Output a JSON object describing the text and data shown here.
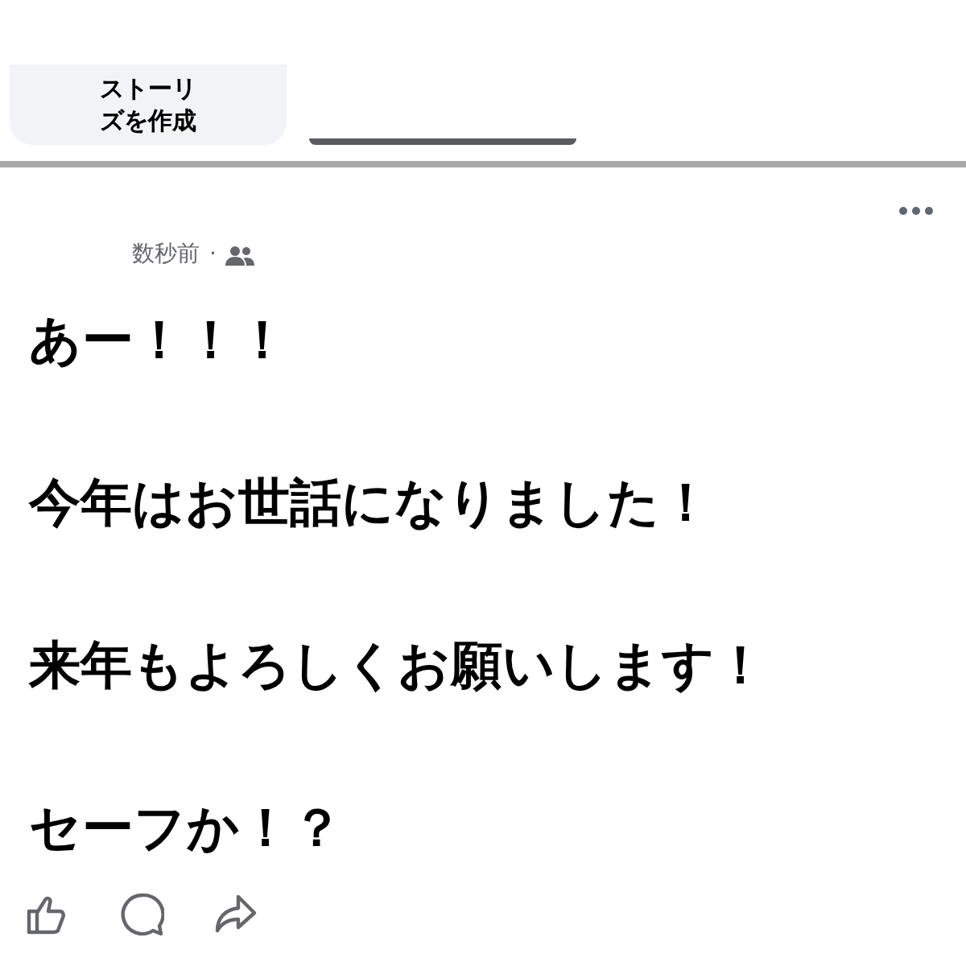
{
  "story_card": {
    "lines": [
      "ストーリ",
      "ズを作成"
    ]
  },
  "post": {
    "time": "数秒前",
    "separator": "·",
    "paragraphs": [
      "あー！！！",
      "今年はお世話になりました！",
      "来年もよろしくお願いします！",
      "セーフか！？"
    ]
  }
}
